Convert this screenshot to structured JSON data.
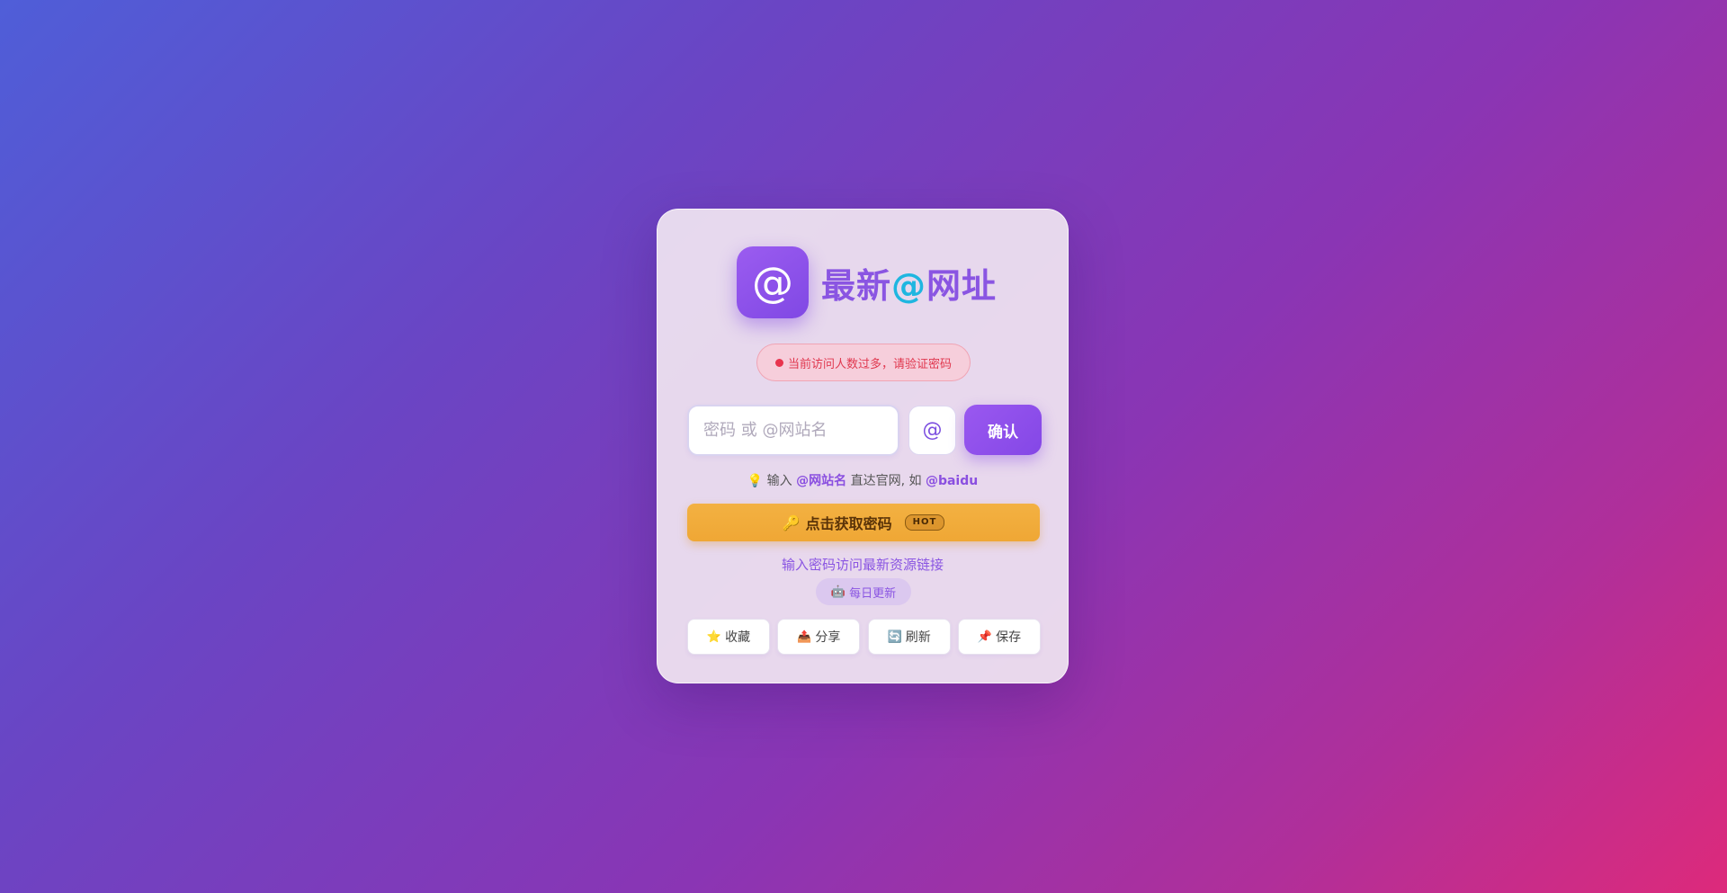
{
  "brand": {
    "logo_symbol": "@",
    "title_part1": "最新",
    "title_at": "@",
    "title_part2": "网址",
    "colors": {
      "primary": "#8a55e2",
      "at_accent": "#1fb6e0"
    }
  },
  "notice": {
    "text": "当前访问人数过多，请验证密码",
    "color": "#e0384f"
  },
  "form": {
    "password_placeholder": "密码 或 @网站名",
    "password_value": "",
    "at_button_label": "@",
    "confirm_label": "确认"
  },
  "hint": {
    "icon": "💡",
    "prefix": "输入",
    "site_token": "@网站名",
    "middle": "直达官网, 如",
    "example": "@baidu"
  },
  "get_password": {
    "icon": "🔑",
    "label": "点击获取密码",
    "badge": "HOT",
    "color": "#f3b142"
  },
  "sub_link": "输入密码访问最新资源链接",
  "update_pill": {
    "icon": "🤖",
    "label": "每日更新"
  },
  "actions": [
    {
      "icon": "⭐",
      "icon_name": "star-icon",
      "label": "收藏"
    },
    {
      "icon": "📤",
      "icon_name": "share-icon",
      "label": "分享"
    },
    {
      "icon": "🔄",
      "icon_name": "refresh-icon",
      "label": "刷新"
    },
    {
      "icon": "📌",
      "icon_name": "pin-icon",
      "label": "保存"
    }
  ]
}
